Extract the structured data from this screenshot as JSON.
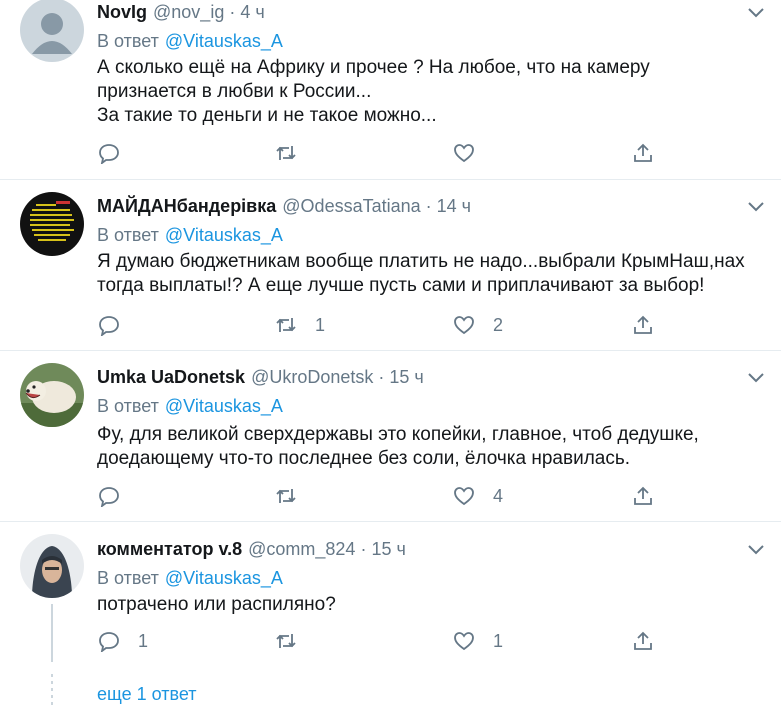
{
  "tweets": [
    {
      "name": "NovIg",
      "handle": "@nov_ig",
      "time": "4 ч",
      "reply_prefix": "В ответ",
      "reply_to": "@Vitauskas_A",
      "lines": [
        "А сколько ещё на Африку и прочее ? На любое, что на камеру",
        "признается в любви к России...",
        "За такие то деньги и не такое можно..."
      ],
      "replies": "",
      "retweets": "",
      "likes": ""
    },
    {
      "name": "МАЙДАНбандерівка",
      "handle": "@OdessaTatiana",
      "time": "14 ч",
      "reply_prefix": "В ответ",
      "reply_to": "@Vitauskas_A",
      "lines": [
        "Я думаю бюджетникам вообще платить не надо...выбрали КрымНаш,нах",
        "тогда выплаты!? А еще лучше пусть сами и приплачивают за выбор!"
      ],
      "replies": "",
      "retweets": "1",
      "likes": "2"
    },
    {
      "name": "Umka UaDonetsk",
      "handle": "@UkroDonetsk",
      "time": "15 ч",
      "reply_prefix": "В ответ",
      "reply_to": "@Vitauskas_A",
      "lines": [
        "Фу, для великой сверхдержавы это копейки, главное, чтоб дедушке,",
        "доедающему что-то последнее без соли, ёлочка нравилась."
      ],
      "replies": "",
      "retweets": "",
      "likes": "4"
    },
    {
      "name": "комментатор v.8",
      "handle": "@comm_824",
      "time": "15 ч",
      "reply_prefix": "В ответ",
      "reply_to": "@Vitauskas_A",
      "lines": [
        "потрачено или распиляно?"
      ],
      "replies": "1",
      "retweets": "",
      "likes": "1"
    }
  ],
  "more_replies": "еще 1 ответ",
  "colors": {
    "link": "#1b95e0",
    "muted": "#657786",
    "text": "#14171a",
    "divider": "#e6ecf0"
  },
  "icons": {
    "reply": "reply-icon",
    "retweet": "retweet-icon",
    "like": "heart-icon",
    "share": "share-icon",
    "menu": "chevron-down-icon"
  }
}
